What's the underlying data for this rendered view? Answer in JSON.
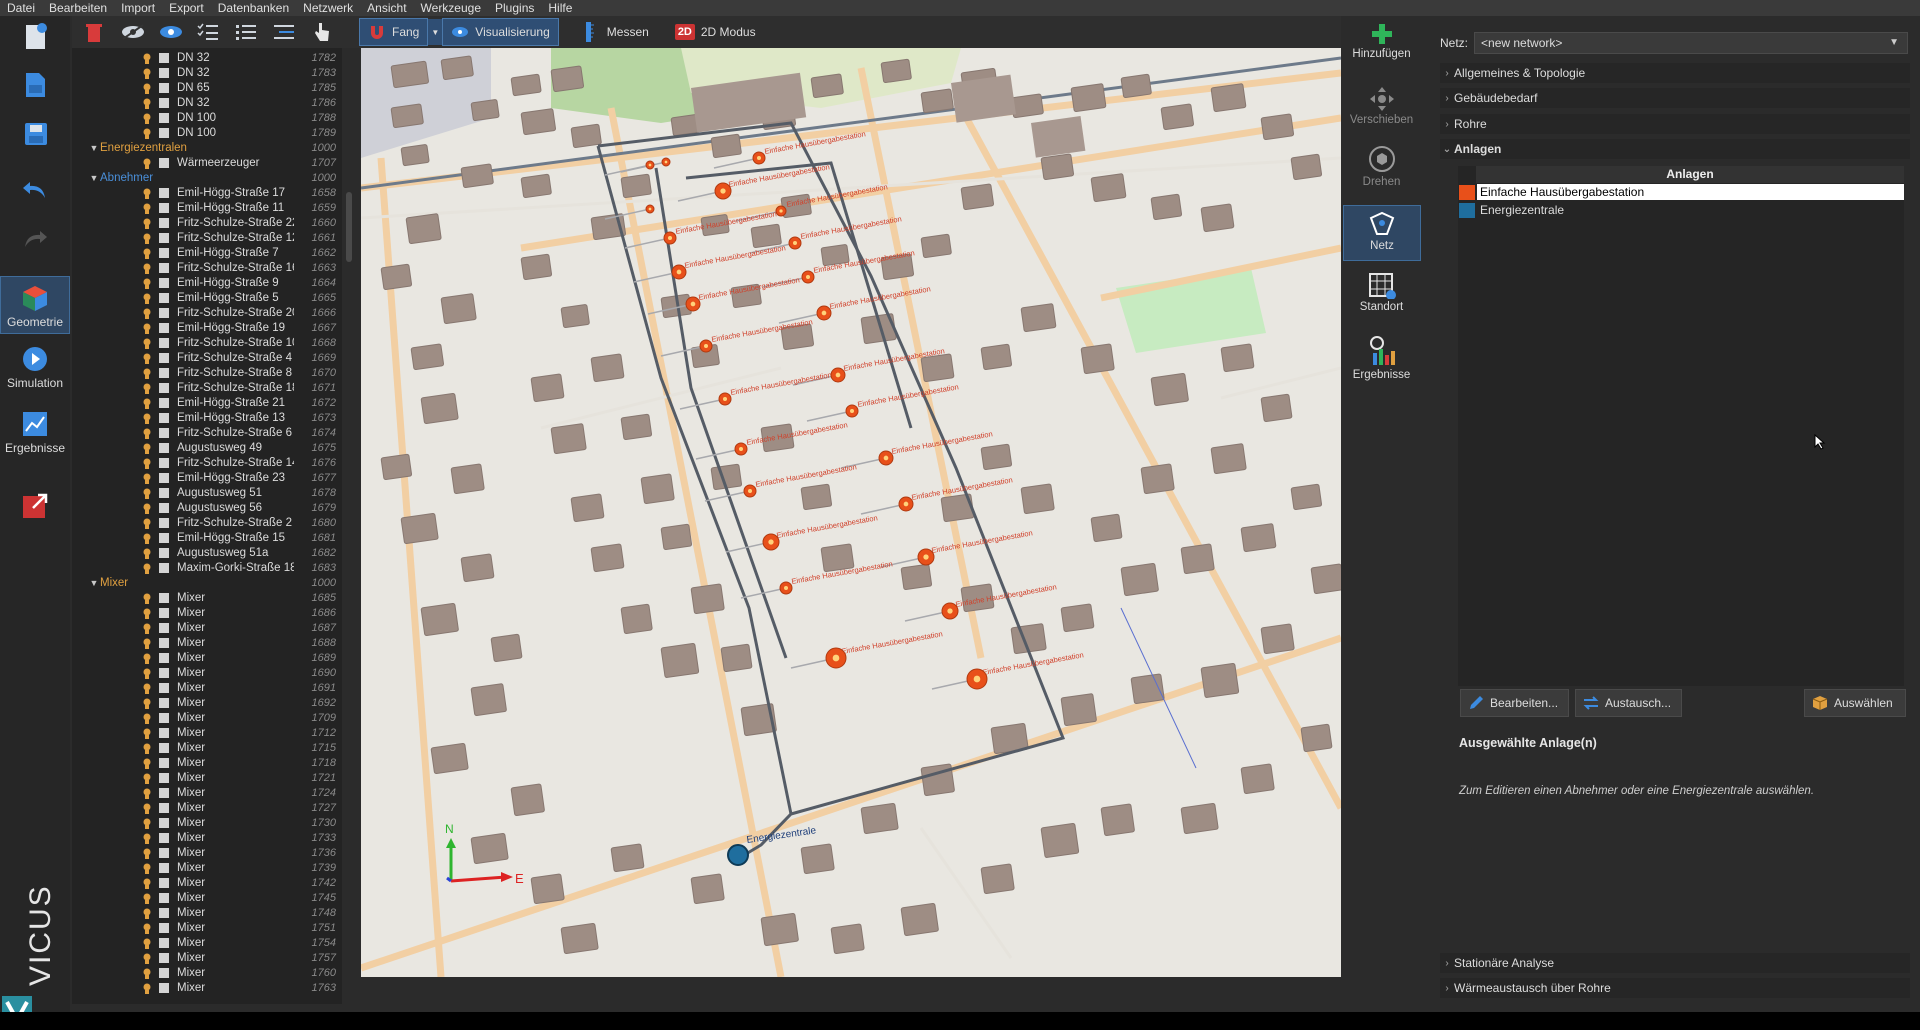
{
  "menu": [
    "Datei",
    "Bearbeiten",
    "Import",
    "Export",
    "Datenbanken",
    "Netzwerk",
    "Ansicht",
    "Werkzeuge",
    "Plugins",
    "Hilfe"
  ],
  "rail": {
    "geometrie": "Geometrie",
    "simulation": "Simulation",
    "ergebnisse": "Ergebnisse",
    "brand": "VICUS"
  },
  "toolbar": {
    "fang": "Fang",
    "visualisierung": "Visualisierung",
    "messen": "Messen",
    "modus_2d": "2D Modus",
    "badge_2d": "2D"
  },
  "tree": {
    "pipes": [
      {
        "label": "DN 32",
        "id": "1782"
      },
      {
        "label": "DN 32",
        "id": "1783"
      },
      {
        "label": "DN 65",
        "id": "1785"
      },
      {
        "label": "DN 32",
        "id": "1786"
      },
      {
        "label": "DN 100",
        "id": "1788"
      },
      {
        "label": "DN 100",
        "id": "1789"
      }
    ],
    "energie_group": {
      "label": "Energiezentralen",
      "id": "1000"
    },
    "energie_items": [
      {
        "label": "Wärmeerzeuger",
        "id": "1707"
      }
    ],
    "abnehmer_group": {
      "label": "Abnehmer",
      "id": "1000"
    },
    "abnehmer_items": [
      {
        "label": "Emil-Högg-Straße 17",
        "id": "1658"
      },
      {
        "label": "Emil-Högg-Straße 11",
        "id": "1659"
      },
      {
        "label": "Fritz-Schulze-Straße 22",
        "id": "1660"
      },
      {
        "label": "Fritz-Schulze-Straße 12",
        "id": "1661"
      },
      {
        "label": "Emil-Högg-Straße 7",
        "id": "1662"
      },
      {
        "label": "Fritz-Schulze-Straße 16",
        "id": "1663"
      },
      {
        "label": "Emil-Högg-Straße 9",
        "id": "1664"
      },
      {
        "label": "Emil-Högg-Straße 5",
        "id": "1665"
      },
      {
        "label": "Fritz-Schulze-Straße 20",
        "id": "1666"
      },
      {
        "label": "Emil-Högg-Straße 19",
        "id": "1667"
      },
      {
        "label": "Fritz-Schulze-Straße 10",
        "id": "1668"
      },
      {
        "label": "Fritz-Schulze-Straße 4",
        "id": "1669"
      },
      {
        "label": "Fritz-Schulze-Straße 8",
        "id": "1670"
      },
      {
        "label": "Fritz-Schulze-Straße 18",
        "id": "1671"
      },
      {
        "label": "Emil-Högg-Straße 21",
        "id": "1672"
      },
      {
        "label": "Emil-Högg-Straße 13",
        "id": "1673"
      },
      {
        "label": "Fritz-Schulze-Straße 6",
        "id": "1674"
      },
      {
        "label": "Augustusweg 49",
        "id": "1675"
      },
      {
        "label": "Fritz-Schulze-Straße 14",
        "id": "1676"
      },
      {
        "label": "Emil-Högg-Straße 23",
        "id": "1677"
      },
      {
        "label": "Augustusweg 51",
        "id": "1678"
      },
      {
        "label": "Augustusweg 56",
        "id": "1679"
      },
      {
        "label": "Fritz-Schulze-Straße 2",
        "id": "1680"
      },
      {
        "label": "Emil-Högg-Straße 15",
        "id": "1681"
      },
      {
        "label": "Augustusweg 51a",
        "id": "1682"
      },
      {
        "label": "Maxim-Gorki-Straße 18",
        "id": "1683"
      }
    ],
    "mixer_group": {
      "label": "Mixer",
      "id": "1000"
    },
    "mixer_items": [
      {
        "label": "Mixer",
        "id": "1685"
      },
      {
        "label": "Mixer",
        "id": "1686"
      },
      {
        "label": "Mixer",
        "id": "1687"
      },
      {
        "label": "Mixer",
        "id": "1688"
      },
      {
        "label": "Mixer",
        "id": "1689"
      },
      {
        "label": "Mixer",
        "id": "1690"
      },
      {
        "label": "Mixer",
        "id": "1691"
      },
      {
        "label": "Mixer",
        "id": "1692"
      },
      {
        "label": "Mixer",
        "id": "1709"
      },
      {
        "label": "Mixer",
        "id": "1712"
      },
      {
        "label": "Mixer",
        "id": "1715"
      },
      {
        "label": "Mixer",
        "id": "1718"
      },
      {
        "label": "Mixer",
        "id": "1721"
      },
      {
        "label": "Mixer",
        "id": "1724"
      },
      {
        "label": "Mixer",
        "id": "1727"
      },
      {
        "label": "Mixer",
        "id": "1730"
      },
      {
        "label": "Mixer",
        "id": "1733"
      },
      {
        "label": "Mixer",
        "id": "1736"
      },
      {
        "label": "Mixer",
        "id": "1739"
      },
      {
        "label": "Mixer",
        "id": "1742"
      },
      {
        "label": "Mixer",
        "id": "1745"
      },
      {
        "label": "Mixer",
        "id": "1748"
      },
      {
        "label": "Mixer",
        "id": "1751"
      },
      {
        "label": "Mixer",
        "id": "1754"
      },
      {
        "label": "Mixer",
        "id": "1757"
      },
      {
        "label": "Mixer",
        "id": "1760"
      },
      {
        "label": "Mixer",
        "id": "1763"
      }
    ]
  },
  "map": {
    "substation_label": "Einfache Hausübergabestation",
    "central_label": "Energiezentrale",
    "compass_n": "N",
    "compass_e": "E"
  },
  "tools": {
    "hinzufuegen": "Hinzufügen",
    "verschieben": "Verschieben",
    "drehen": "Drehen",
    "netz": "Netz",
    "standort": "Standort",
    "ergebnisse": "Ergebnisse"
  },
  "panel": {
    "netz_label": "Netz:",
    "netz_value": "<new network>",
    "sections": {
      "allgemeines": "Allgemeines & Topologie",
      "gebaeude": "Gebäudebedarf",
      "rohre": "Rohre",
      "anlagen": "Anlagen",
      "stationaer": "Stationäre Analyse",
      "waerme": "Wärmeaustausch über Rohre"
    },
    "anlagen_header": "Anlagen",
    "anlagen": [
      {
        "name": "Einfache Hausübergabestation",
        "color": "#e8501a"
      },
      {
        "name": "Energiezentrale",
        "color": "#1f6e9e"
      }
    ],
    "buttons": {
      "bearbeiten": "Bearbeiten...",
      "austausch": "Austausch...",
      "auswaehlen": "Auswählen"
    },
    "selected_title": "Ausgewählte Anlage(n)",
    "selected_hint": "Zum Editieren einen Abnehmer oder eine Energiezentrale auswählen."
  },
  "colors": {
    "accent": "#2f4e74",
    "substation": "#e8501a",
    "central": "#1f6e9e",
    "group_orange": "#e0a040",
    "group_blue": "#4a8fd9"
  }
}
